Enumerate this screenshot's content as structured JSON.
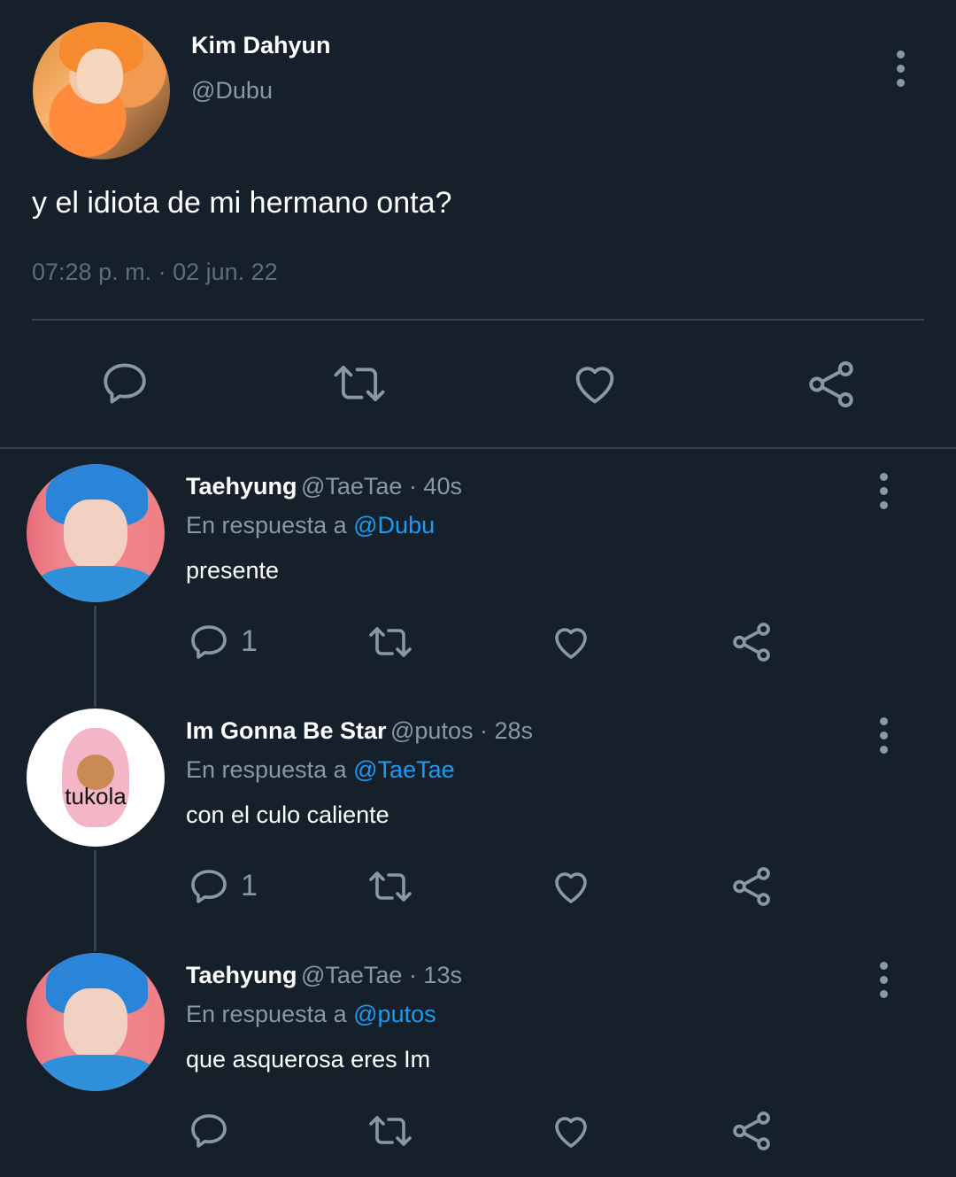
{
  "main_tweet": {
    "name": "Kim Dahyun",
    "handle": "@Dubu",
    "text": "y el idiota de mi hermano onta?",
    "timestamp": "07:28 p. m. · 02 jun. 22",
    "actions": [
      "reply-icon",
      "retweet-icon",
      "like-icon",
      "share-icon"
    ]
  },
  "replies": [
    {
      "name": "Taehyung",
      "meta": "@TaeTae · 40s",
      "reply_prefix": "En respuesta a",
      "reply_to": "@Dubu",
      "text": "presente",
      "reply_count": "1"
    },
    {
      "name": "Im Gonna Be Star",
      "meta": "@putos · 28s",
      "reply_prefix": "En respuesta a",
      "reply_to": "@TaeTae",
      "text": "con el culo caliente",
      "reply_count": "1",
      "avatar_label": "tukola"
    },
    {
      "name": "Taehyung",
      "meta": "@TaeTae · 13s",
      "reply_prefix": "En respuesta a",
      "reply_to": "@putos",
      "text": "que asquerosa eres Im",
      "reply_count": ""
    }
  ],
  "colors": {
    "background": "#15202b",
    "secondary_text": "#8899a6",
    "link": "#1d9bf0",
    "divider": "#38444d"
  }
}
